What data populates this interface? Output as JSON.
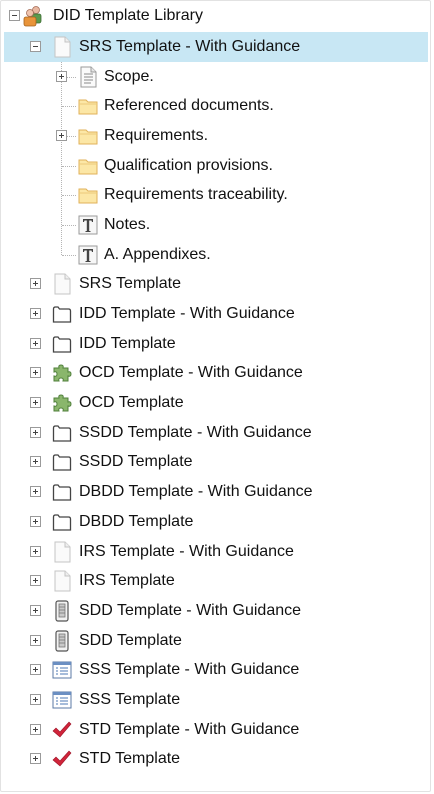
{
  "tree": {
    "root": {
      "label": "DID Template Library",
      "icon": "people-icon",
      "expanded": true
    },
    "selected": {
      "label": "SRS Template - With Guidance",
      "icon": "document-icon",
      "expanded": true
    },
    "children": [
      {
        "label": "Scope.",
        "icon": "text-document-icon",
        "expander": "plus"
      },
      {
        "label": "Referenced documents.",
        "icon": "folder-icon",
        "expander": ""
      },
      {
        "label": "Requirements.",
        "icon": "folder-icon",
        "expander": "plus"
      },
      {
        "label": "Qualification provisions.",
        "icon": "folder-icon",
        "expander": ""
      },
      {
        "label": "Requirements traceability.",
        "icon": "folder-icon",
        "expander": ""
      },
      {
        "label": "Notes.",
        "icon": "text-t-icon",
        "expander": ""
      },
      {
        "label": "A. Appendixes.",
        "icon": "text-t-icon",
        "expander": ""
      }
    ],
    "templates": [
      {
        "label": "SRS Template",
        "icon": "document-icon"
      },
      {
        "label": "IDD Template - With Guidance",
        "icon": "interface-icon"
      },
      {
        "label": "IDD Template",
        "icon": "interface-icon"
      },
      {
        "label": "OCD Template - With Guidance",
        "icon": "puzzle-icon"
      },
      {
        "label": "OCD Template",
        "icon": "puzzle-icon"
      },
      {
        "label": "SSDD Template - With Guidance",
        "icon": "interface-icon"
      },
      {
        "label": "SSDD Template",
        "icon": "interface-icon"
      },
      {
        "label": "DBDD Template - With Guidance",
        "icon": "interface-icon"
      },
      {
        "label": "DBDD Template",
        "icon": "interface-icon"
      },
      {
        "label": "IRS Template - With Guidance",
        "icon": "document-icon"
      },
      {
        "label": "IRS Template",
        "icon": "document-icon"
      },
      {
        "label": "SDD Template - With Guidance",
        "icon": "server-icon"
      },
      {
        "label": "SDD Template",
        "icon": "server-icon"
      },
      {
        "label": "SSS Template - With Guidance",
        "icon": "list-window-icon"
      },
      {
        "label": "SSS Template",
        "icon": "list-window-icon"
      },
      {
        "label": "STD Template - With Guidance",
        "icon": "checkmark-icon"
      },
      {
        "label": "STD Template",
        "icon": "checkmark-icon"
      }
    ]
  },
  "colors": {
    "selection": "#c8e7f4",
    "folder": "#fce7a6",
    "check": "#d0243a",
    "puzzle": "#8ab66c"
  }
}
